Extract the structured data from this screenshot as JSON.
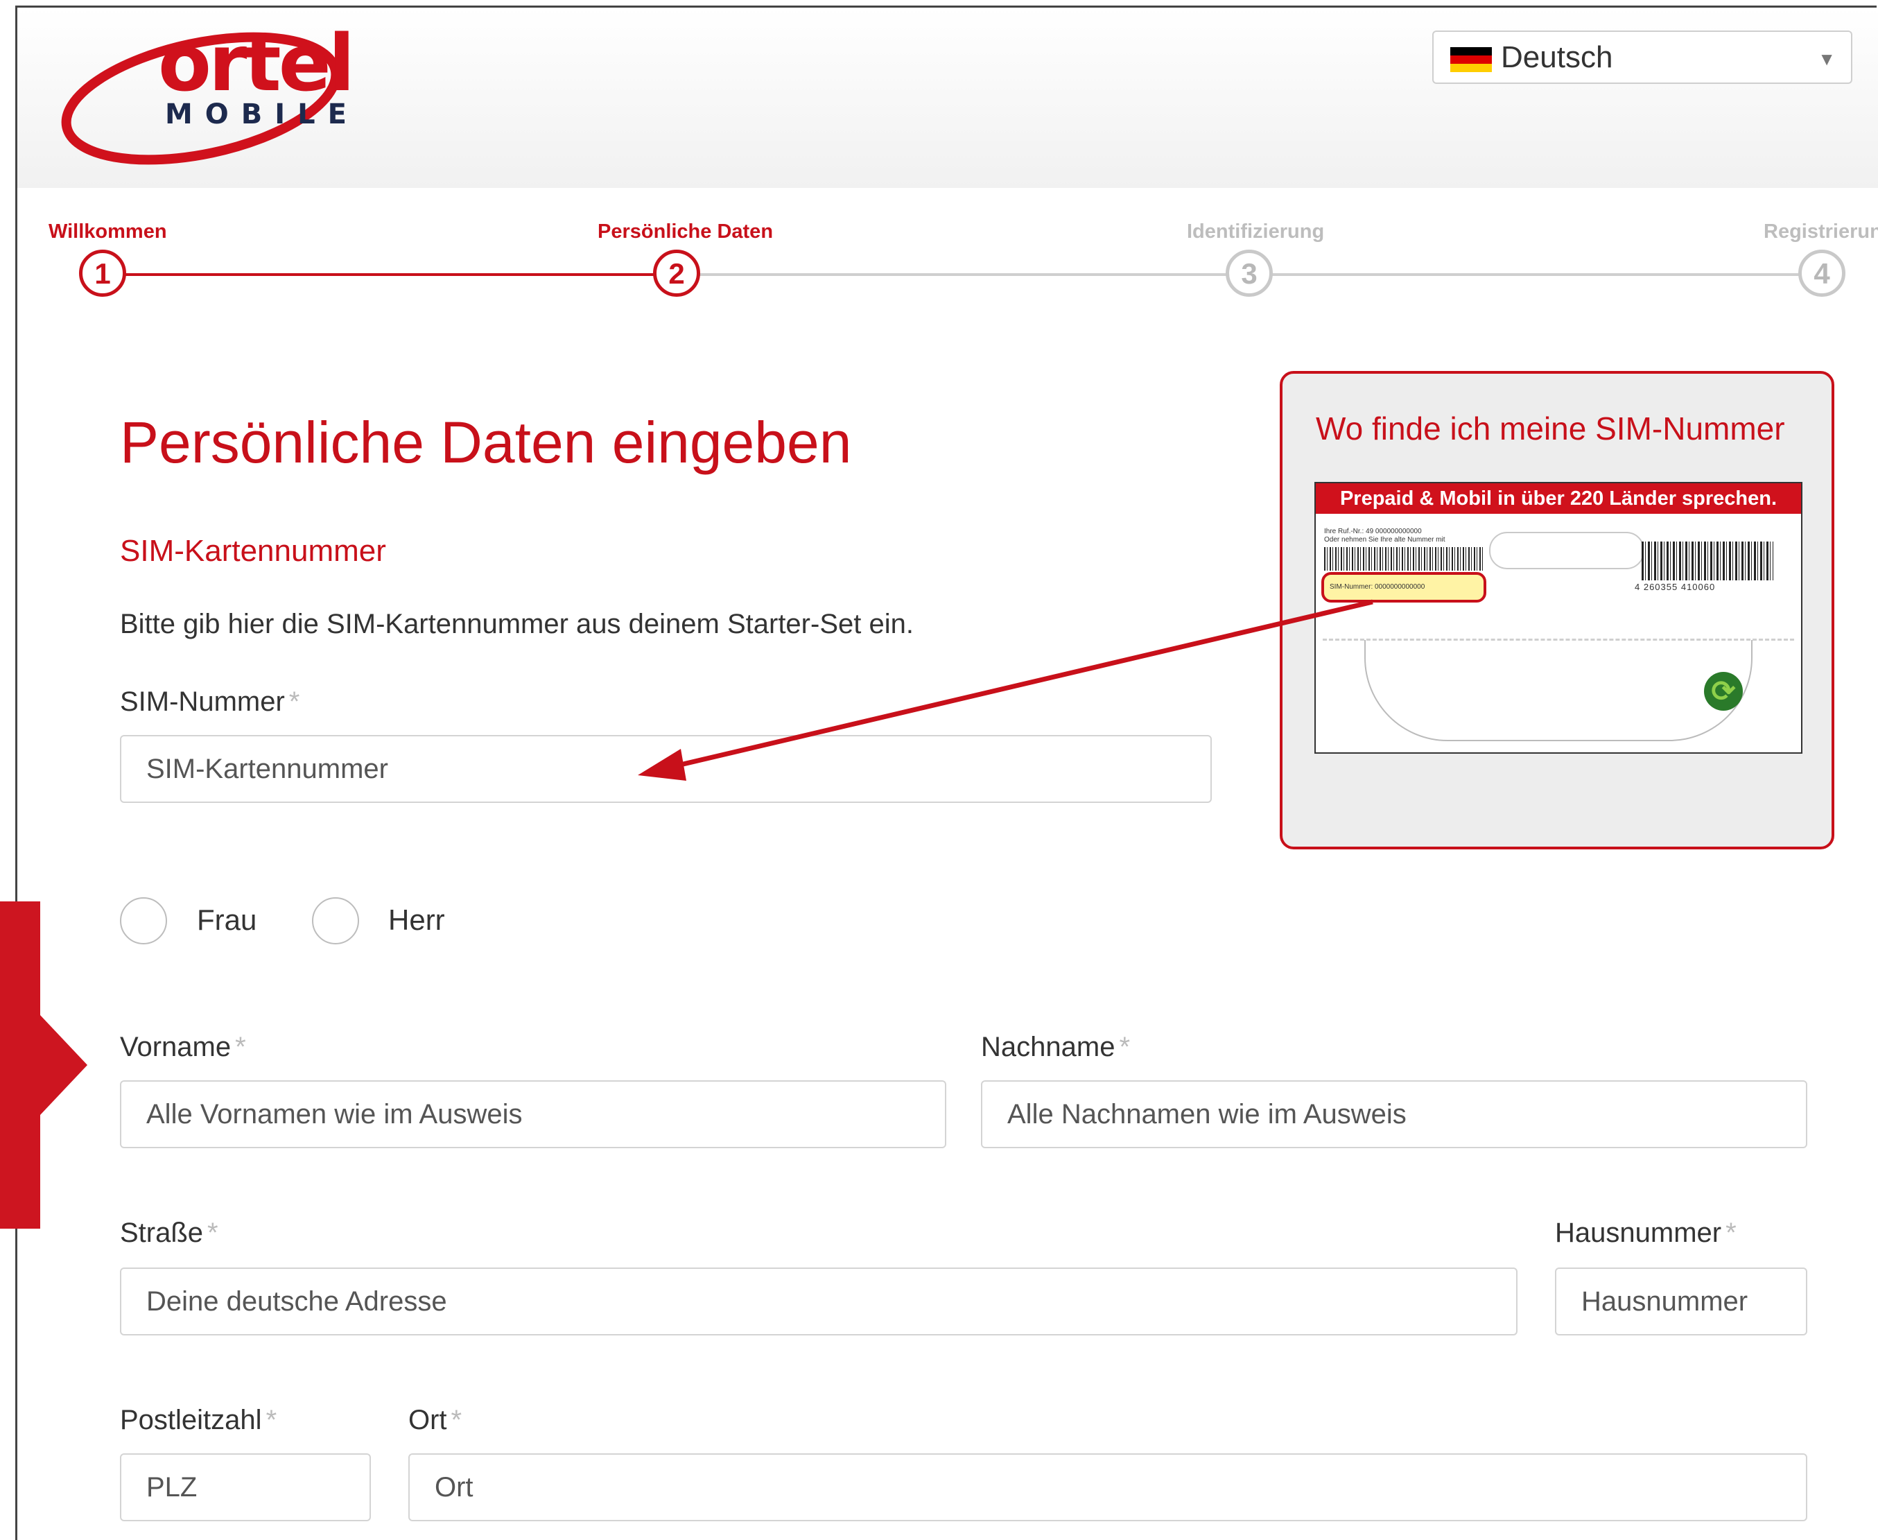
{
  "brand": {
    "word": "ortel",
    "sub": "MOBILE",
    "color": "#d0111c"
  },
  "language": {
    "selected": "Deutsch",
    "flag_icon": "germany-flag-icon"
  },
  "steps": [
    {
      "number": "1",
      "label": "Willkommen",
      "state": "active"
    },
    {
      "number": "2",
      "label": "Persönliche Daten",
      "state": "active"
    },
    {
      "number": "3",
      "label": "Identifizierung",
      "state": "inactive"
    },
    {
      "number": "4",
      "label": "Registrierung",
      "state": "inactive"
    }
  ],
  "form": {
    "title": "Persönliche Daten eingeben",
    "section": "SIM-Kartennummer",
    "helper": "Bitte gib hier die SIM-Kartennummer aus deinem Starter-Set ein.",
    "required_mark": "*",
    "sim": {
      "label": "SIM-Nummer",
      "placeholder": "SIM-Kartennummer"
    },
    "salutation": [
      "Frau",
      "Herr"
    ],
    "vorname": {
      "label": "Vorname",
      "placeholder": "Alle Vornamen wie im Ausweis"
    },
    "nachname": {
      "label": "Nachname",
      "placeholder": "Alle Nachnamen wie im Ausweis"
    },
    "strasse": {
      "label": "Straße",
      "placeholder": "Deine deutsche Adresse"
    },
    "hausnummer": {
      "label": "Hausnummer",
      "placeholder": "Hausnummer"
    },
    "plz": {
      "label": "Postleitzahl",
      "placeholder": "PLZ"
    },
    "ort": {
      "label": "Ort",
      "placeholder": "Ort"
    }
  },
  "info": {
    "title": "Wo finde ich meine SIM-Nummer",
    "card_banner": "Prepaid & Mobil in über 220 Länder sprechen.",
    "card_line1": "Ihre Ruf.-Nr.: 49 000000000000",
    "card_line2": "Oder nehmen Sie Ihre alte Nummer mit",
    "card_sim": "SIM-Nummer: 0000000000000",
    "card_ean": "4 260355 410060"
  },
  "colors": {
    "accent": "#c8101a",
    "inactive": "#c9c9c9"
  }
}
